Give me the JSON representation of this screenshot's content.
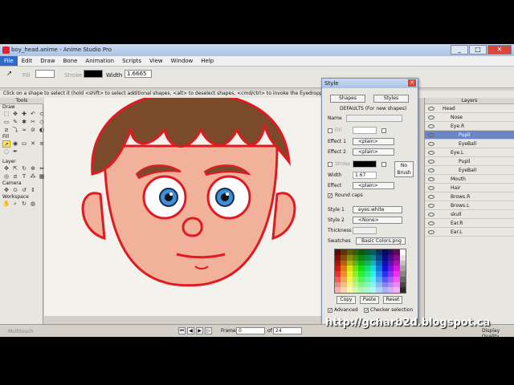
{
  "window": {
    "title": "boy_head.anime - Anime Studio Pro",
    "buttons": [
      "_",
      "□",
      "✕"
    ]
  },
  "menu": [
    "File",
    "Edit",
    "Draw",
    "Bone",
    "Animation",
    "Scripts",
    "View",
    "Window",
    "Help"
  ],
  "options": {
    "fill_label": "Fill",
    "stroke_label": "Stroke",
    "width_label": "Width",
    "width_value": "1.6665"
  },
  "status_text": "Click on a shape to select it (hold <shift> to select additional shapes, <alt> to deselect shapes, <cmd/ctrl> to invoke the Eyedropper tool)",
  "tools": {
    "header": "Tools",
    "sections": [
      "Draw",
      "Fill",
      "Layer",
      "Camera",
      "Workspace"
    ]
  },
  "style_panel": {
    "title": "Style",
    "tabs": [
      "Shapes",
      "Styles"
    ],
    "defaults_label": "DEFAULTS (For new shapes)",
    "name_label": "Name",
    "fill_label": "Fill",
    "effect1_label": "Effect 1",
    "effect1_value": "<plain>",
    "effect2_label": "Effect 2",
    "effect2_value": "<plain>",
    "stroke_label": "Stroke",
    "no_brush": "No Brush",
    "width_label": "Width",
    "width_value": "1.67",
    "effect_label": "Effect",
    "effect_value": "<plain>",
    "round_caps": "Round caps",
    "style1_label": "Style 1",
    "style1_value": "eyes.white",
    "style2_label": "Style 2",
    "style2_value": "<None>",
    "thickness_label": "Thickness",
    "swatches_label": "Swatches",
    "swatches_value": "Basic Colors.png",
    "copy": "Copy",
    "paste": "Paste",
    "reset": "Reset",
    "advanced": "Advanced",
    "checker": "Checker selection"
  },
  "layers": {
    "header": "Layers",
    "items": [
      {
        "name": "Head",
        "level": 0,
        "selected": false
      },
      {
        "name": "Nose",
        "level": 1,
        "selected": false
      },
      {
        "name": "Eye.R",
        "level": 1,
        "selected": false
      },
      {
        "name": "Pupil",
        "level": 2,
        "selected": true
      },
      {
        "name": "EyeBall",
        "level": 2,
        "selected": false
      },
      {
        "name": "Eye.L",
        "level": 1,
        "selected": false
      },
      {
        "name": "Pupil",
        "level": 2,
        "selected": false
      },
      {
        "name": "EyeBall",
        "level": 2,
        "selected": false
      },
      {
        "name": "Mouth",
        "level": 1,
        "selected": false
      },
      {
        "name": "Hair",
        "level": 1,
        "selected": false
      },
      {
        "name": "Brows.R",
        "level": 1,
        "selected": false
      },
      {
        "name": "Brows.L",
        "level": 1,
        "selected": false
      },
      {
        "name": "skull",
        "level": 1,
        "selected": false
      },
      {
        "name": "Ear.R",
        "level": 1,
        "selected": false
      },
      {
        "name": "Ear.L",
        "level": 1,
        "selected": false
      }
    ]
  },
  "timeline": {
    "multitouch": "Multitouch",
    "frame_label": "Frame",
    "frame_value": "0",
    "of_label": "of",
    "total_frames": "24",
    "display_quality": "Display Quality"
  },
  "watermark": "http://gcharb2d.blogspot.ca",
  "colors": {
    "skin": "#f2b19b",
    "outline": "#e11a22",
    "hair": "#7a4a2a",
    "iris": "#3d8fd6",
    "selection": "#316ac5"
  }
}
